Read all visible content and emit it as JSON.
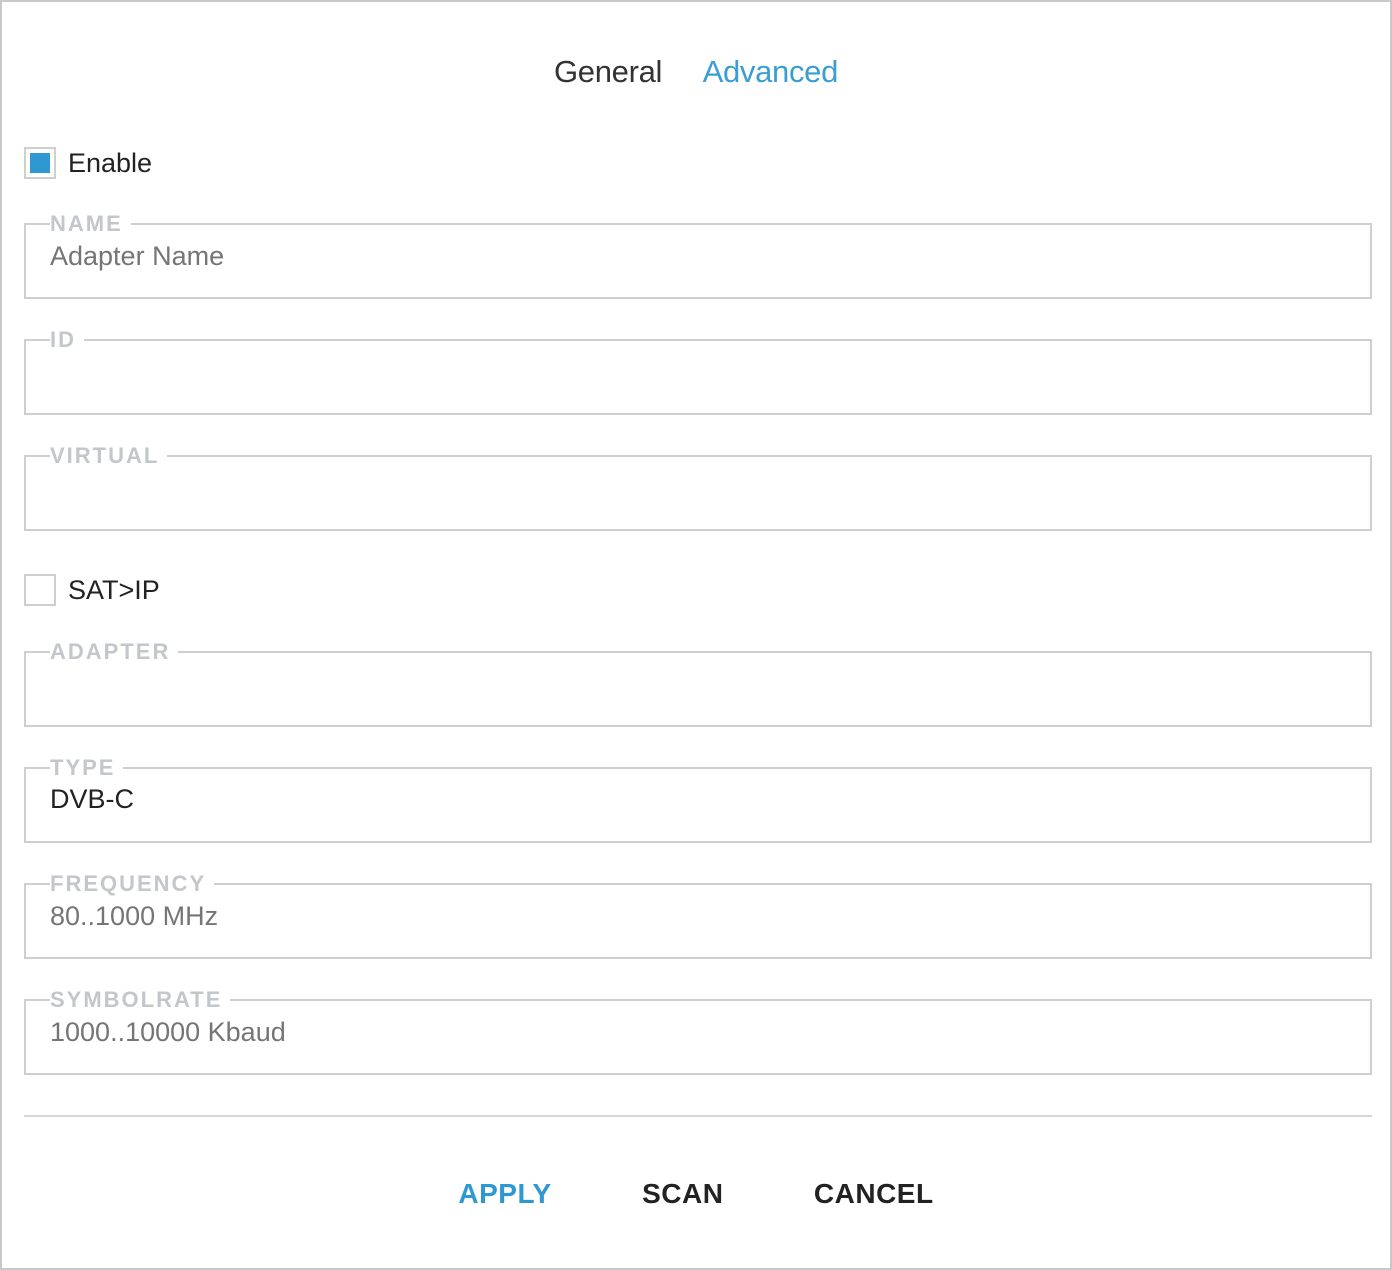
{
  "tabs": {
    "general": "General",
    "advanced": "Advanced"
  },
  "enable": {
    "label": "Enable",
    "checked": true
  },
  "fields": {
    "name": {
      "label": "NAME",
      "placeholder": "Adapter Name",
      "value": ""
    },
    "id": {
      "label": "ID",
      "value": ""
    },
    "virtual": {
      "label": "VIRTUAL",
      "value": ""
    },
    "adapter": {
      "label": "ADAPTER",
      "value": ""
    },
    "type": {
      "label": "TYPE",
      "value": "DVB-C"
    },
    "frequency": {
      "label": "FREQUENCY",
      "placeholder": "80..1000 MHz",
      "value": ""
    },
    "symbolrate": {
      "label": "SYMBOLRATE",
      "placeholder": "1000..10000 Kbaud",
      "value": ""
    }
  },
  "satip": {
    "label": "SAT>IP",
    "checked": false
  },
  "actions": {
    "apply": "APPLY",
    "scan": "SCAN",
    "cancel": "CANCEL"
  },
  "colors": {
    "accent": "#2f98d2",
    "border": "#cfcfcf",
    "legend": "#c3c6cb"
  }
}
